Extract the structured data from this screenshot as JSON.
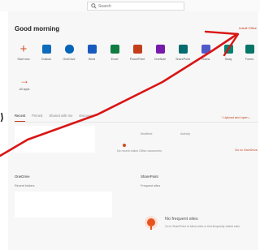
{
  "search": {
    "placeholder": "Search"
  },
  "header": {
    "greeting": "Good morning",
    "install_label": "Install Office"
  },
  "apps": [
    {
      "label": "Start new",
      "icon": "plus-icon",
      "color": "#d04a20"
    },
    {
      "label": "Outlook",
      "icon": "outlook-icon",
      "color": "#0f6cbd"
    },
    {
      "label": "OneDrive",
      "icon": "onedrive-icon",
      "color": "#0364b8"
    },
    {
      "label": "Word",
      "icon": "word-icon",
      "color": "#185abd"
    },
    {
      "label": "Excel",
      "icon": "excel-icon",
      "color": "#107c41"
    },
    {
      "label": "PowerPoint",
      "icon": "powerpoint-icon",
      "color": "#c43e1c"
    },
    {
      "label": "OneNote",
      "icon": "onenote-icon",
      "color": "#7719aa"
    },
    {
      "label": "SharePoint",
      "icon": "sharepoint-icon",
      "color": "#036c70"
    },
    {
      "label": "Teams",
      "icon": "teams-icon",
      "color": "#5059c9"
    },
    {
      "label": "Sway",
      "icon": "sway-icon",
      "color": "#008272"
    },
    {
      "label": "Forms",
      "icon": "forms-icon",
      "color": "#077568"
    }
  ],
  "more_apps": {
    "label": "All apps"
  },
  "tabs": [
    "Recent",
    "Pinned",
    "Shared with me",
    "Discover"
  ],
  "upload_label": "↑ Upload and open...",
  "recent": {
    "col_modified": "Modified",
    "col_activity": "Activity",
    "empty_text": "No recent online Office documents",
    "onedrive_link": "Go to OneDrive"
  },
  "onedrive_section": {
    "title": "OneDrive",
    "subtitle": "Recent folders"
  },
  "sharepoint_section": {
    "title": "SharePoint",
    "subtitle": "Frequent sites"
  },
  "no_frequent": {
    "title": "No frequent sites",
    "description": "Go to SharePoint to follow sites or find frequently visited sites."
  }
}
